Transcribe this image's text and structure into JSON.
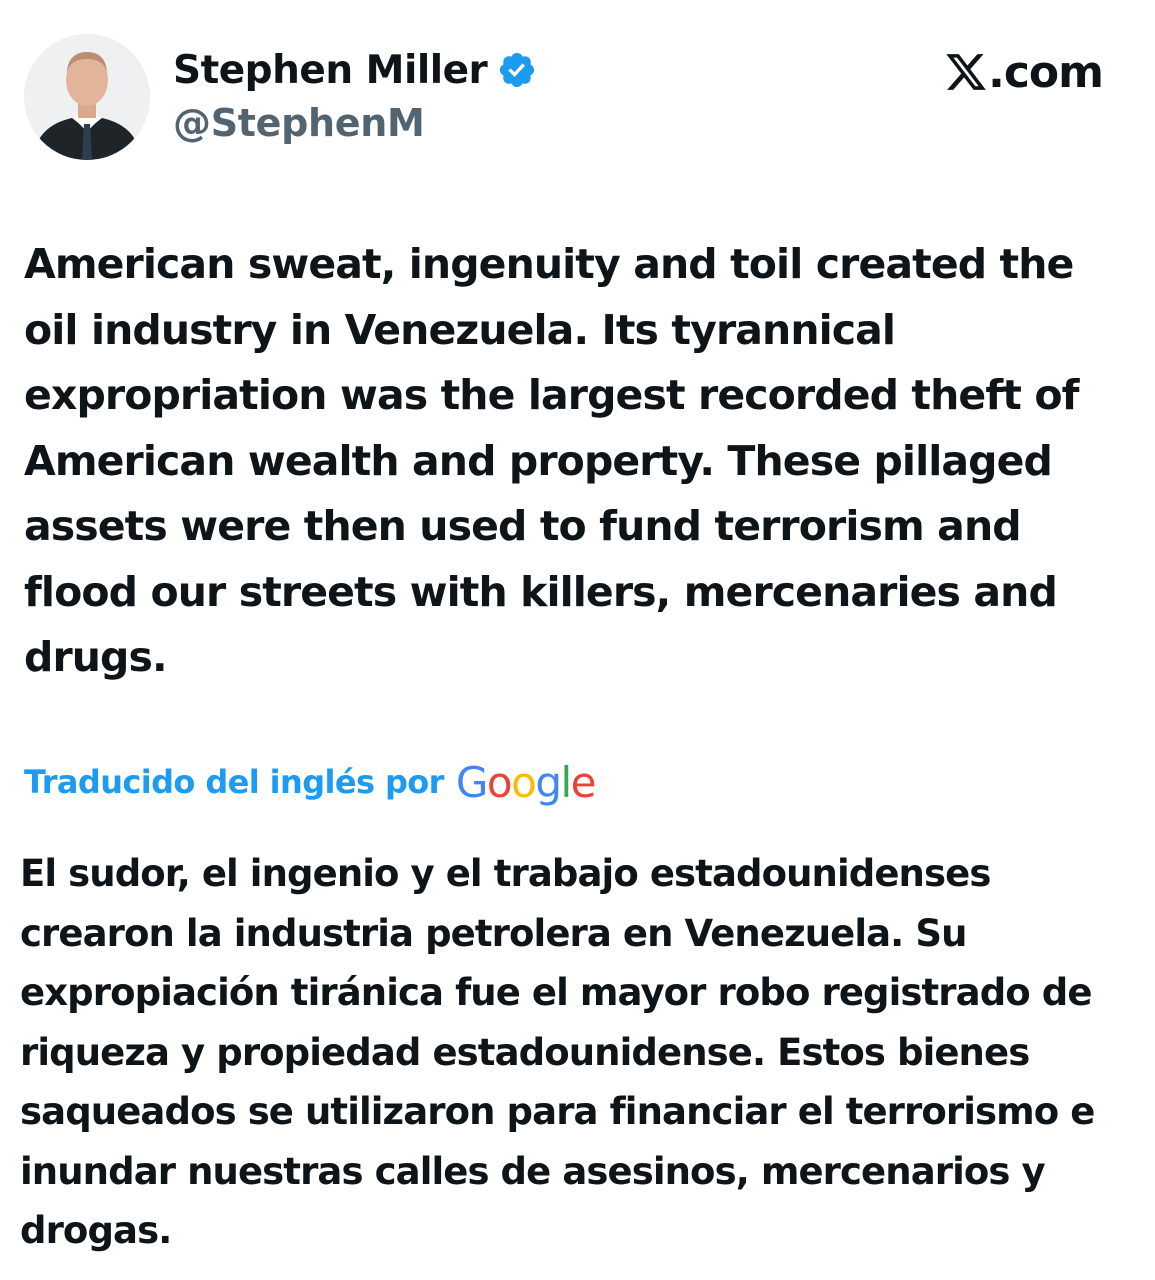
{
  "author": {
    "display_name": "Stephen Miller",
    "handle": "@StephenM",
    "verified_badge_icon": "verified-badge-icon",
    "verified_color": "#1d9bf0"
  },
  "site": {
    "label": ".com",
    "logo_icon": "x-logo-icon"
  },
  "tweet": {
    "text": "American sweat, ingenuity and toil created the oil industry in Venezuela. Its tyrannical expropriation was the largest recorded theft of American wealth and property. These pillaged assets were then used to fund terrorism and flood our streets with killers, mercenaries and drugs."
  },
  "translation": {
    "label": "Traducido del inglés por",
    "provider": "Google",
    "label_color": "#1d9bf0",
    "text": "El sudor, el ingenio y el trabajo estadounidenses crearon la industria petrolera en Venezuela. Su expropiación tiránica fue el mayor robo registrado de riqueza y propiedad estadounidense. Estos bienes saqueados se utilizaron para financiar el terrorismo e inundar nuestras calles de asesinos, mercenarios y drogas."
  }
}
